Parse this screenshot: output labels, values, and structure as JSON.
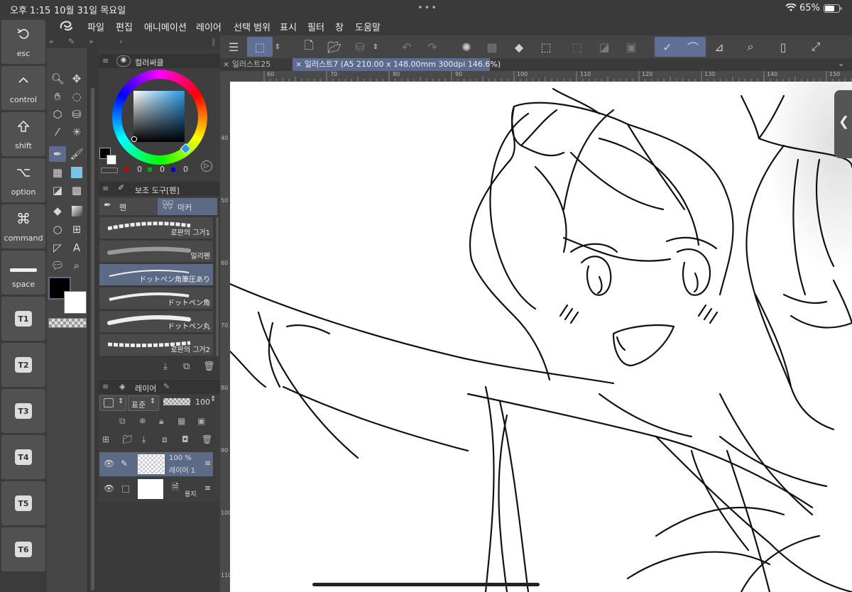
{
  "status_bar": {
    "time": "오후 1:15",
    "date": "10월 31일 목요일",
    "battery": "65%"
  },
  "shortcut_keys": [
    {
      "label": "esc",
      "icon": "esc-icon"
    },
    {
      "label": "control",
      "icon": "control-icon"
    },
    {
      "label": "shift",
      "icon": "shift-icon"
    },
    {
      "label": "option",
      "icon": "option-icon"
    },
    {
      "label": "command",
      "icon": "command-icon"
    },
    {
      "label": "space",
      "icon": "space-icon"
    },
    {
      "label": "T1"
    },
    {
      "label": "T2"
    },
    {
      "label": "T3"
    },
    {
      "label": "T4"
    },
    {
      "label": "T5"
    },
    {
      "label": "T6"
    }
  ],
  "menu": [
    "파일",
    "편집",
    "애니메이션",
    "레이어",
    "선택 범위",
    "표시",
    "필터",
    "창",
    "도움말"
  ],
  "color_panel": {
    "title": "컬러써클",
    "r": "0",
    "g": "0",
    "b": "0"
  },
  "sub_tool_panel": {
    "title": "보조 도구[펜]",
    "tabs": [
      "펜",
      "마커"
    ]
  },
  "brushes": [
    "로판의 그거1",
    "밀리펜",
    "ドットペン角筆圧あり",
    "ドットペン角",
    "ドットペン丸",
    "로판의 그거2"
  ],
  "layer_panel": {
    "title": "레이어",
    "blend_mode": "표준",
    "opacity": "100",
    "layers": [
      {
        "opacity": "100 %",
        "name": "레이어 1"
      },
      {
        "name": "용지"
      }
    ]
  },
  "tabs": [
    {
      "label": "일러스트25"
    },
    {
      "label": "일러스트7 (A5 210.00 x 148.00mm 300dpi 146.6%)"
    }
  ],
  "ruler_h": [
    "60",
    "70",
    "80",
    "90",
    "100",
    "110",
    "120",
    "130",
    "140",
    "150"
  ],
  "ruler_v": [
    "40",
    "50",
    "60",
    "70",
    "80",
    "90",
    "100",
    "110"
  ]
}
